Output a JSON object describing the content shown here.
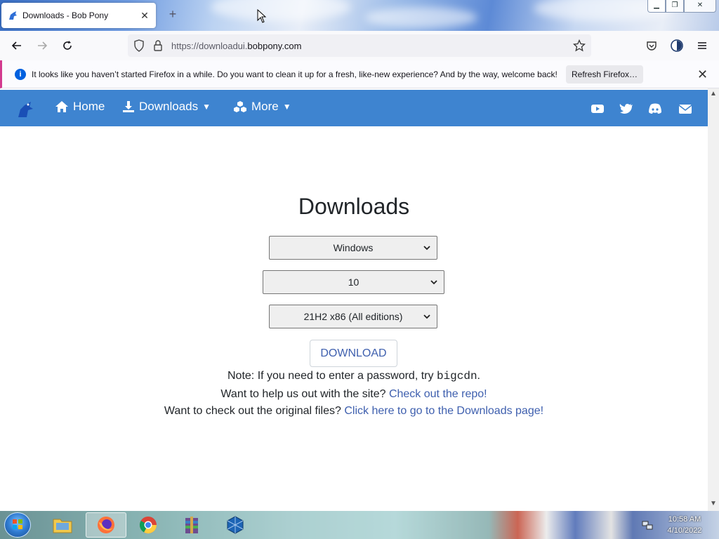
{
  "browser": {
    "tab_title": "Downloads - Bob Pony",
    "new_tab_symbol": "+",
    "url_prefix": "https://downloadui.",
    "url_host": "bobpony.com"
  },
  "notification": {
    "message": "It looks like you haven’t started Firefox in a while. Do you want to clean it up for a fresh, like-new experience? And by the way, welcome back!",
    "button_label": "Refresh Firefox…"
  },
  "site_nav": {
    "home": "Home",
    "downloads": "Downloads",
    "more": "More"
  },
  "main": {
    "title": "Downloads",
    "os_select": "Windows",
    "version_select": "10",
    "build_select": "21H2 x86 (All editions)",
    "download_button": "DOWNLOAD",
    "note_prefix": "Note: If you need to enter a password, try ",
    "note_password": "bigcdn",
    "note_suffix": ".",
    "help_prefix": "Want to help us out with the site? ",
    "help_link": "Check out the repo!",
    "files_prefix": "Want to check out the original files? ",
    "files_link": "Click here to go to the Downloads page!"
  },
  "taskbar": {
    "time": "10:58 AM",
    "date": "4/10/2022"
  },
  "colors": {
    "site_nav_bg": "#3e84d0",
    "link": "#3e5fae",
    "notification_accent": "#d33a8f"
  }
}
